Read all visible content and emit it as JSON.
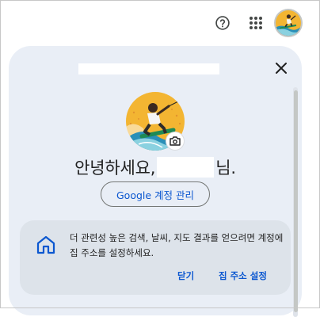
{
  "topbar": {
    "help_icon": "help-circle-icon",
    "apps_icon": "apps-grid-icon",
    "avatar": "profile-avatar"
  },
  "account_panel": {
    "close_icon": "close-icon",
    "camera_icon": "camera-icon",
    "greeting_prefix": "안녕하세요,",
    "greeting_suffix": "님.",
    "manage_account_label": "Google 계정 관리"
  },
  "home_address_card": {
    "icon": "home-icon",
    "message": "더 관련성 높은 검색, 날씨, 지도 결과를 얻으려면 계정에 집 주소를 설정하세요.",
    "dismiss_label": "닫기",
    "set_address_label": "집 주소 설정"
  },
  "colors": {
    "panel_bg": "#e9eef6",
    "card_bg": "#dde3ea",
    "link_blue": "#0b57d0",
    "home_icon_blue": "#0b57d0"
  }
}
